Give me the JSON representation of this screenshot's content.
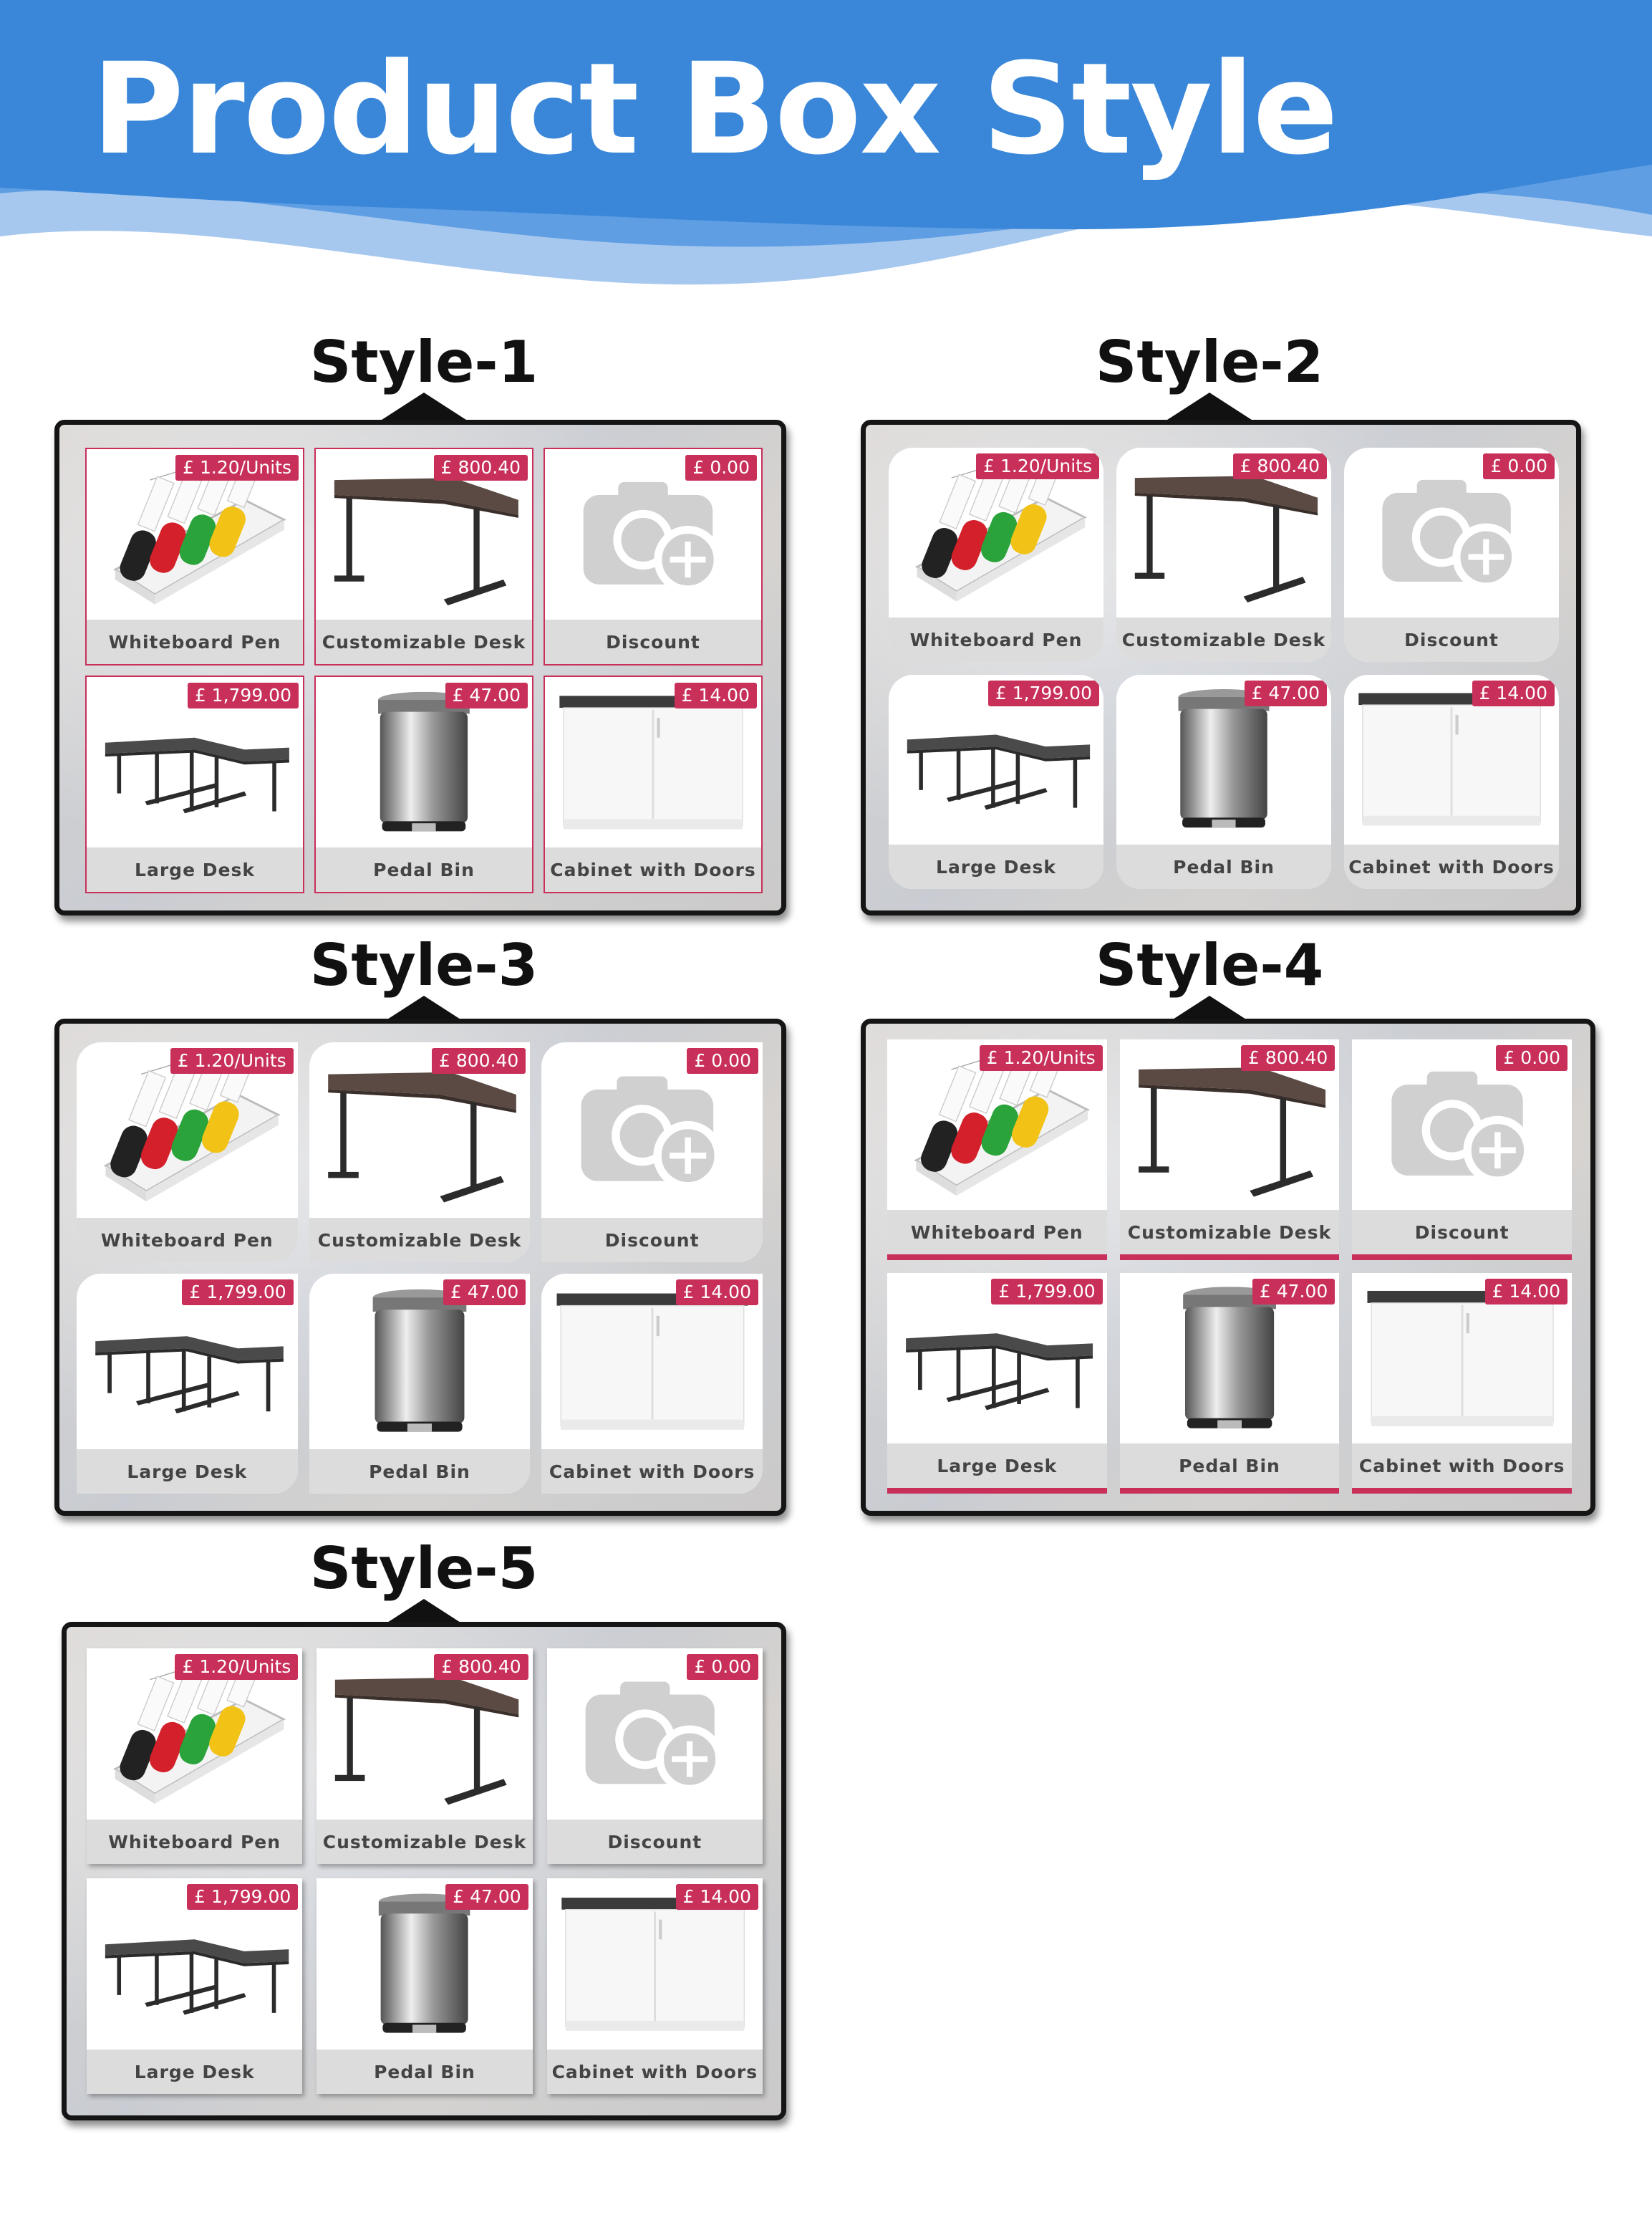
{
  "page": {
    "title": "Product Box Style",
    "accent_color": "#c8305a",
    "header_color": "#3a87d9"
  },
  "products": [
    {
      "name": "Whiteboard Pen",
      "price": "£ 1.20/Units",
      "image": "whiteboard-pen-tray"
    },
    {
      "name": "Customizable Desk",
      "price": "£ 800.40",
      "image": "corner-desk"
    },
    {
      "name": "Discount",
      "price": "£ 0.00",
      "image": "camera-add-placeholder"
    },
    {
      "name": "Large Desk",
      "price": "£ 1,799.00",
      "image": "large-desk"
    },
    {
      "name": "Pedal Bin",
      "price": "£ 47.00",
      "image": "pedal-bin"
    },
    {
      "name": "Cabinet with Doors",
      "price": "£ 14.00",
      "image": "cabinet-with-doors"
    }
  ],
  "styles": [
    {
      "label": "Style-1"
    },
    {
      "label": "Style-2"
    },
    {
      "label": "Style-3"
    },
    {
      "label": "Style-4"
    },
    {
      "label": "Style-5"
    }
  ]
}
